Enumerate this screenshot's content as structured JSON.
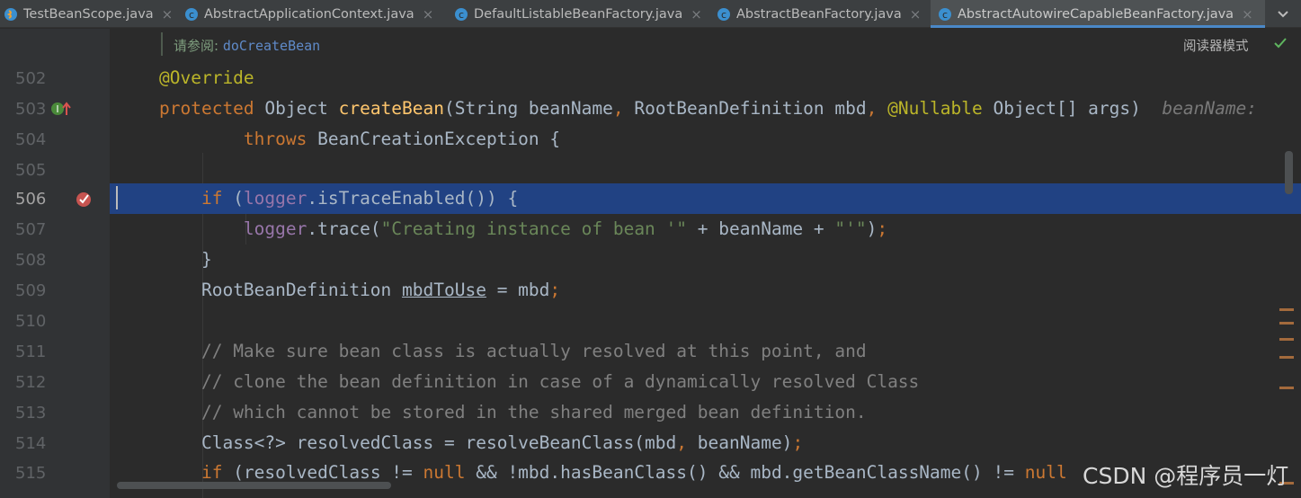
{
  "tabs": [
    {
      "label": "TestBeanScope.java",
      "icon": "java-class-icon",
      "active": false
    },
    {
      "label": "AbstractApplicationContext.java",
      "icon": "class-icon",
      "active": false
    },
    {
      "label": "DefaultListableBeanFactory.java",
      "icon": "class-icon",
      "active": false
    },
    {
      "label": "AbstractBeanFactory.java",
      "icon": "class-icon",
      "active": false
    },
    {
      "label": "AbstractAutowireCapableBeanFactory.java",
      "icon": "abstract-class-icon",
      "active": true
    }
  ],
  "tab_close_glyph": "×",
  "hint": {
    "prefix": "请参阅: ",
    "link": "doCreateBean"
  },
  "reader_mode": "阅读器模式",
  "lines": [
    {
      "num": "502"
    },
    {
      "num": "503"
    },
    {
      "num": "504"
    },
    {
      "num": "505"
    },
    {
      "num": "506"
    },
    {
      "num": "507"
    },
    {
      "num": "508"
    },
    {
      "num": "509"
    },
    {
      "num": "510"
    },
    {
      "num": "511"
    },
    {
      "num": "512"
    },
    {
      "num": "513"
    },
    {
      "num": "514"
    },
    {
      "num": "515"
    }
  ],
  "code": {
    "l502": {
      "annotation": "@Override"
    },
    "l503": {
      "mod": "protected",
      "type": "Object ",
      "name": "createBean",
      "p1": "(String beanName",
      "c1": ", ",
      "p2": "RootBeanDefinition mbd",
      "c2": ", ",
      "ann": "@Nullable",
      "p3": " Object[] args)",
      "hint": "beanName:"
    },
    "l504": {
      "kw": "throws",
      "rest": " BeanCreationException {"
    },
    "l506": {
      "kw": "if",
      "a": " (",
      "field": "logger",
      "b": ".isTraceEnabled()) {"
    },
    "l507": {
      "field": "logger",
      "a": ".trace(",
      "str1": "\"Creating instance of bean '\"",
      "b": " + beanName + ",
      "str2": "\"'\"",
      "c": ")",
      "semi": ";"
    },
    "l508": {
      "text": "}"
    },
    "l509": {
      "type": "RootBeanDefinition ",
      "var": "mbdToUse",
      "rest": " = mbd",
      "semi": ";"
    },
    "l511": {
      "comment": "// Make sure bean class is actually resolved at this point, and"
    },
    "l512": {
      "comment": "// clone the bean definition in case of a dynamically resolved Class"
    },
    "l513": {
      "comment": "// which cannot be stored in the shared merged bean definition."
    },
    "l514": {
      "a": "Class<?> resolvedClass = resolveBeanClass(mbd",
      "c": ", ",
      "b": "beanName)",
      "semi": ";"
    },
    "l515": {
      "kw": "if",
      "a": " (resolvedClass != ",
      "null1": "null",
      "b": " && !mbd.hasBeanClass() && mbd.getBeanClassName() != ",
      "null2": "null"
    }
  },
  "watermark": "CSDN @程序员一灯",
  "colors": {
    "keyword": "#cc7832",
    "annotation": "#bbb529",
    "method": "#ffc66d",
    "string": "#6a8759",
    "comment": "#808080",
    "field": "#9876aa",
    "selection": "#214283"
  }
}
